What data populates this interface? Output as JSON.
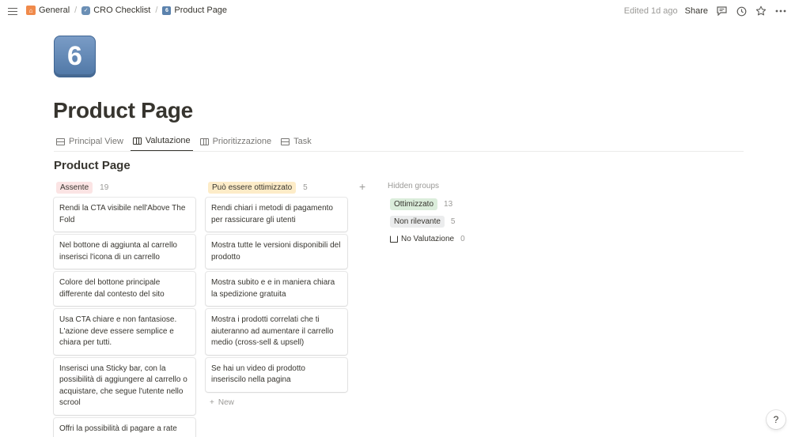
{
  "breadcrumb": [
    {
      "label": "General",
      "icon": "home-icon"
    },
    {
      "label": "CRO Checklist",
      "icon": "checklist-icon"
    },
    {
      "label": "Product Page",
      "icon": "number-six-icon"
    }
  ],
  "breadcrumb_separator": "/",
  "top_right": {
    "edited": "Edited 1d ago",
    "share": "Share"
  },
  "page": {
    "icon_glyph": "6",
    "title": "Product Page"
  },
  "tabs": [
    {
      "label": "Principal View",
      "type": "table"
    },
    {
      "label": "Valutazione",
      "type": "board",
      "active": true
    },
    {
      "label": "Prioritizzazione",
      "type": "board"
    },
    {
      "label": "Task",
      "type": "table"
    }
  ],
  "board": {
    "title": "Product Page",
    "columns": [
      {
        "label": "Assente",
        "count": "19",
        "color": "#fbe4e4",
        "cards": [
          "Rendi la CTA visibile nell'Above The Fold",
          "Nel bottone di aggiunta al carrello inserisci l'icona di un carrello",
          "Colore del bottone principale differente dal contesto del sito",
          "Usa CTA chiare e non fantasiose. L'azione deve essere semplice e chiara per tutti.",
          "Inserisci una Sticky bar, con la possibilità di aggiungere al carrello o acquistare, che segue l'utente nello scrool",
          "Offri la possibilità di pagare a rate"
        ]
      },
      {
        "label": "Può essere ottimizzato",
        "count": "5",
        "color": "#fdecc8",
        "cards": [
          "Rendi chiari i metodi di pagamento per rassicurare gli utenti",
          "Mostra tutte le versioni disponibili del prodotto",
          "Mostra subito e e in maniera chiara la spedizione gratuita",
          "Mostra i prodotti correlati che ti aiuteranno ad aumentare il carrello medio (cross-sell & upsell)",
          "Se hai un video di prodotto inseriscilo nella pagina"
        ],
        "new_label": "New"
      }
    ],
    "add_group_symbol": "+",
    "hidden_groups": {
      "title": "Hidden groups",
      "items": [
        {
          "label": "Ottimizzato",
          "count": "13",
          "color": "#dbeddb"
        },
        {
          "label": "Non rilevante",
          "count": "5",
          "color": "#ebeced"
        },
        {
          "label": "No Valutazione",
          "count": "0",
          "icon": "inbox-icon"
        }
      ]
    }
  },
  "help_label": "?"
}
